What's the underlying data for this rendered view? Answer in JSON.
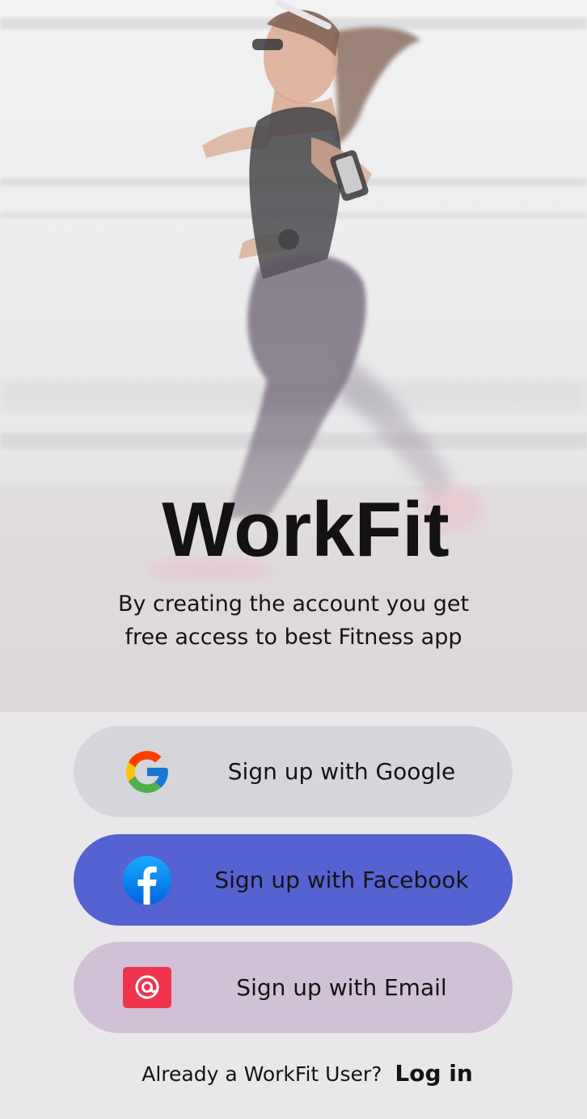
{
  "hero": {
    "image_description_icon": "running-woman-photo",
    "app_title": "WorkFit",
    "subtitle_line1": "By creating the account you get",
    "subtitle_line2": "free access to best Fitness app"
  },
  "buttons": {
    "google": {
      "label": "Sign up with Google",
      "icon": "google-icon",
      "bg": "#d4d6db"
    },
    "facebook": {
      "label": "Sign up with Facebook",
      "icon": "facebook-icon",
      "bg": "#5562d2"
    },
    "email": {
      "label": "Sign up with Email",
      "icon": "email-at-icon",
      "bg": "#d1c1d6"
    }
  },
  "footer": {
    "prompt": "Already a WorkFit User?",
    "login_label": "Log in"
  },
  "colors": {
    "background": "#e9e7e9",
    "text": "#151314",
    "email_icon_bg": "#f0344d",
    "facebook_blue": "#1877f2"
  }
}
